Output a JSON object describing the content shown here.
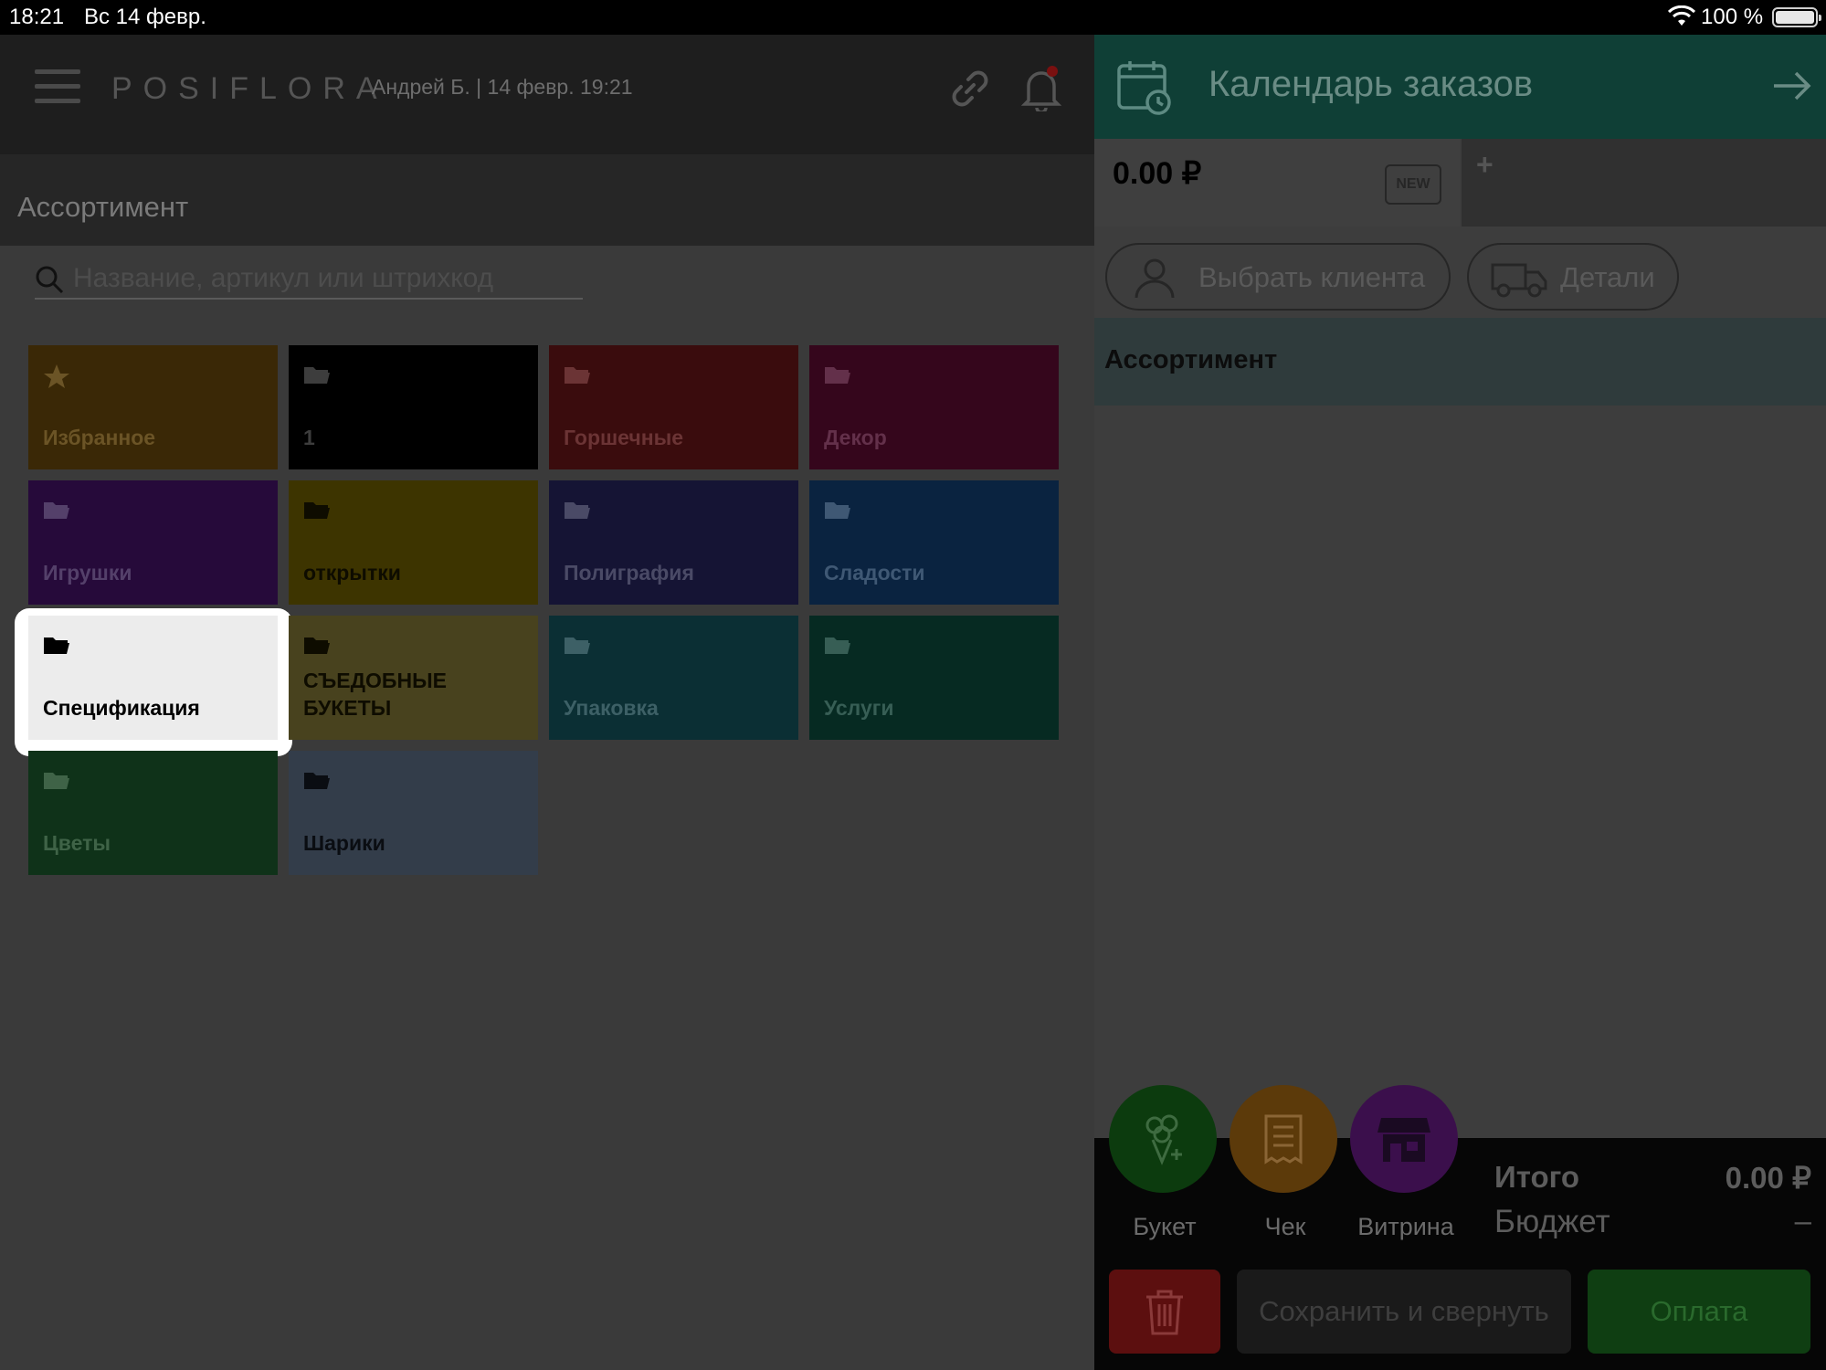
{
  "status_bar": {
    "time": "18:21",
    "date": "Вс 14 февр.",
    "battery_percent": "100 %"
  },
  "header": {
    "logo": "POSIFLORA",
    "user_info": "Андрей Б.  | 14 февр. 19:21",
    "section_title": "Ассортимент"
  },
  "search": {
    "placeholder": "Название, артикул или штрихкод",
    "value": ""
  },
  "categories": [
    {
      "label": "Избранное",
      "icon": "star-icon",
      "color": "#3a2806",
      "text_color": "#6b5426"
    },
    {
      "label": "1",
      "icon": "folder-icon",
      "color": "#000000",
      "text_color": "#3d3d3d"
    },
    {
      "label": "Горшечные",
      "icon": "folder-icon",
      "color": "#3a0c0d",
      "text_color": "#6b3435"
    },
    {
      "label": "Декор",
      "icon": "folder-icon",
      "color": "#35061c",
      "text_color": "#63304a"
    },
    {
      "label": "Игрушки",
      "icon": "folder-icon",
      "color": "#260a3a",
      "text_color": "#54406a"
    },
    {
      "label": "открытки",
      "icon": "folder-icon",
      "color": "#3d3400",
      "text_color": "#0e0c00"
    },
    {
      "label": "Полиграфия",
      "icon": "folder-icon",
      "color": "#151434",
      "text_color": "#4a4a66"
    },
    {
      "label": "Сладости",
      "icon": "folder-icon",
      "color": "#0a2340",
      "text_color": "#3f5874"
    },
    {
      "label": "Спецификация",
      "icon": "folder-icon",
      "color": "#ececec",
      "text_color": "#000000",
      "highlighted": true
    },
    {
      "label": "СЪЕДОБНЫЕ БУКЕТЫ",
      "icon": "folder-icon",
      "color": "#48421e",
      "text_color": "#0e0c00"
    },
    {
      "label": "Упаковка",
      "icon": "folder-icon",
      "color": "#0b2f34",
      "text_color": "#3d6066"
    },
    {
      "label": "Услуги",
      "icon": "folder-icon",
      "color": "#062a22",
      "text_color": "#375e55"
    },
    {
      "label": "Цветы",
      "icon": "folder-icon",
      "color": "#0f3219",
      "text_color": "#3f6347"
    },
    {
      "label": "Шарики",
      "icon": "folder-icon",
      "color": "#333d4a",
      "text_color": "#0a0d12"
    }
  ],
  "calendar": {
    "title": "Календарь заказов"
  },
  "order": {
    "amount": "0.00 ₽",
    "badge": "NEW",
    "add_tab": "+"
  },
  "client_button": "Выбрать клиента",
  "details_button": "Детали",
  "cart_section": "Ассортимент",
  "actions": [
    {
      "label": "Букет",
      "icon": "bouquet-icon",
      "color": "#0c3b0e"
    },
    {
      "label": "Чек",
      "icon": "receipt-icon",
      "color": "#5c3a0a"
    },
    {
      "label": "Витрина",
      "icon": "showcase-icon",
      "color": "#3b0f4c"
    }
  ],
  "totals": {
    "total_label": "Итого",
    "total_value": "0.00 ₽",
    "budget_label": "Бюджет",
    "budget_value": "–"
  },
  "buttons": {
    "save": "Сохранить и свернуть",
    "pay": "Оплата"
  }
}
